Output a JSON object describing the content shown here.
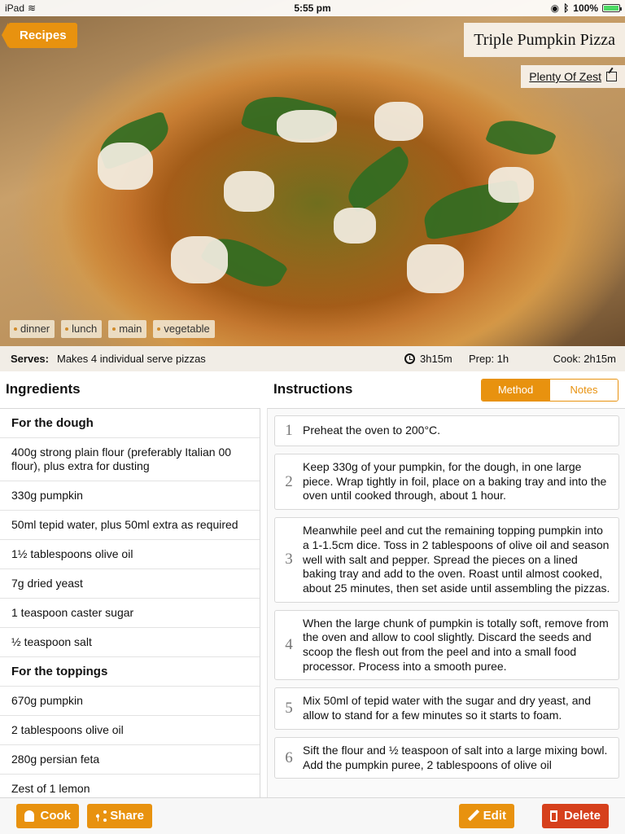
{
  "status_bar": {
    "device": "iPad",
    "time": "5:55 pm",
    "battery": "100%",
    "battery_level": 1.0
  },
  "nav": {
    "back_label": "Recipes"
  },
  "recipe": {
    "title": "Triple Pumpkin Pizza",
    "source": "Plenty Of Zest",
    "tags": [
      "dinner",
      "lunch",
      "main",
      "vegetable"
    ],
    "serves_label": "Serves:",
    "serves_value": "Makes 4 individual serve pizzas",
    "total_time": "3h15m",
    "prep_time": "Prep: 1h",
    "cook_time": "Cook: 2h15m"
  },
  "ingredients": {
    "heading": "Ingredients",
    "rows": [
      {
        "text": "For the dough",
        "heading": true
      },
      {
        "text": "400g strong plain flour (preferably Italian 00 flour), plus extra for dusting",
        "heading": false
      },
      {
        "text": "330g pumpkin",
        "heading": false
      },
      {
        "text": "50ml tepid water, plus 50ml extra as required",
        "heading": false
      },
      {
        "text": "1½ tablespoons olive oil",
        "heading": false
      },
      {
        "text": "7g dried yeast",
        "heading": false
      },
      {
        "text": "1 teaspoon caster sugar",
        "heading": false
      },
      {
        "text": "½ teaspoon salt",
        "heading": false
      },
      {
        "text": "For the toppings",
        "heading": true
      },
      {
        "text": "670g pumpkin",
        "heading": false
      },
      {
        "text": "2 tablespoons olive oil",
        "heading": false
      },
      {
        "text": "280g persian feta",
        "heading": false
      },
      {
        "text": "Zest of 1 lemon",
        "heading": false
      }
    ]
  },
  "instructions": {
    "heading": "Instructions",
    "tabs": {
      "method": "Method",
      "notes": "Notes"
    },
    "steps": [
      {
        "num": "1",
        "text": "Preheat the oven to 200°C."
      },
      {
        "num": "2",
        "text": "Keep 330g of your pumpkin, for the dough, in one large piece. Wrap tightly in foil, place on a baking tray and into the oven until cooked through, about 1 hour."
      },
      {
        "num": "3",
        "text": "Meanwhile peel and cut the remaining topping pumpkin into a 1-1.5cm dice. Toss in 2 tablespoons of olive oil and season well with salt and pepper. Spread the pieces on a lined baking tray and add to the oven. Roast until almost cooked, about 25 minutes, then set aside until assembling the pizzas."
      },
      {
        "num": "4",
        "text": "When the large chunk of pumpkin is totally soft, remove from the oven and allow to cool slightly. Discard the seeds and scoop the flesh out from the peel and into a small food processor. Process into a smooth puree."
      },
      {
        "num": "5",
        "text": "Mix 50ml of tepid water with the sugar and dry yeast, and allow to stand for a few minutes so it starts to foam."
      },
      {
        "num": "6",
        "text": "Sift the flour and ½ teaspoon of salt into a large mixing bowl. Add the pumpkin puree, 2 tablespoons of olive oil"
      }
    ]
  },
  "toolbar": {
    "cook": "Cook",
    "share": "Share",
    "edit": "Edit",
    "delete": "Delete"
  },
  "colors": {
    "accent": "#e8920f",
    "danger": "#d6401c"
  }
}
